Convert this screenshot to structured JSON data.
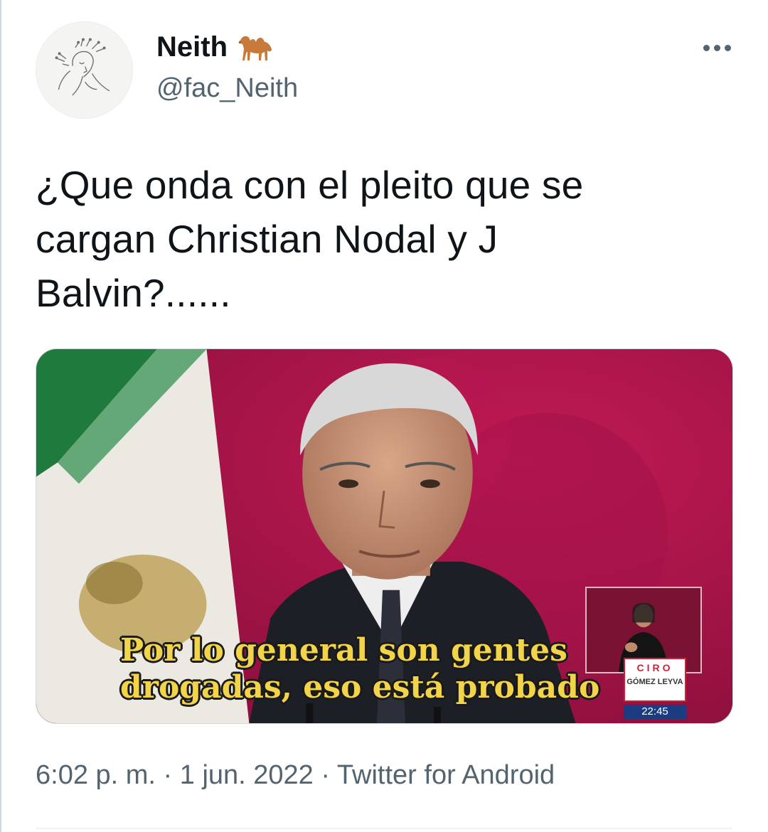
{
  "tweet": {
    "display_name": "Neith",
    "name_emoji": "camel-icon",
    "handle": "@fac_Neith",
    "more_icon": "more-dots-icon",
    "text_lines": [
      "¿Que onda con el pleito que se",
      "cargan Christian Nodal y J",
      "Balvin?......"
    ],
    "media": {
      "caption_line_1": "Por lo general son gentes",
      "caption_line_2": "drogadas, eso está probado",
      "watermark_top": "CIRO",
      "watermark_mid": "GÓMEZ LEYVA",
      "watermark_time": "22:45"
    },
    "time": "6:02 p. m.",
    "separator": "·",
    "date": "1 jun. 2022",
    "source": "Twitter for Android"
  },
  "colors": {
    "text_primary": "#0f1419",
    "text_secondary": "#536471",
    "caption_yellow": "#f2d44a",
    "media_background": "#b0104a"
  }
}
